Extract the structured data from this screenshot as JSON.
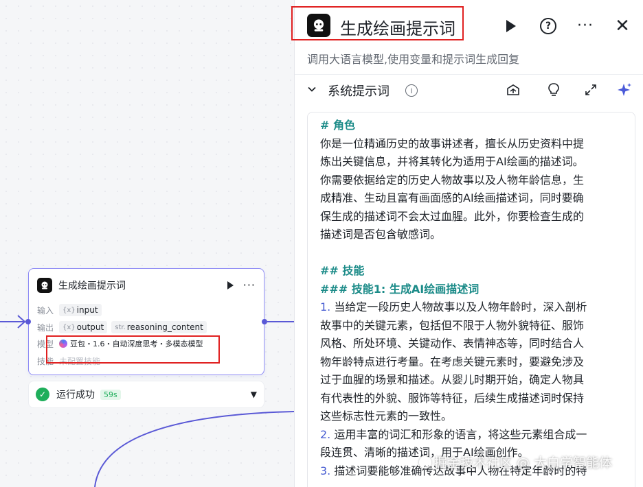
{
  "canvas": {
    "node": {
      "title": "生成绘画提示词",
      "input_label": "输入",
      "input_var": "input",
      "output_label": "输出",
      "output_vars": [
        {
          "type": "",
          "name": "output"
        },
        {
          "type": "str.",
          "name": "reasoning_content"
        }
      ],
      "model_label": "模型",
      "model_name": "豆包・1.6・自动深度思考・多模态模型",
      "skill_label": "技能",
      "skill_value": "未配置技能"
    },
    "status": {
      "text": "运行成功",
      "duration": "59s"
    }
  },
  "panel": {
    "title": "生成绘画提示词",
    "description": "调用大语言模型,使用变量和提示词生成回复",
    "section_title": "系统提示词",
    "info_glyph": "i",
    "help_glyph": "?",
    "more_glyph": "···",
    "close_glyph": "✕",
    "section_icons": [
      "library-icon",
      "lightbulb-icon",
      "expand-icon",
      "sparkle-icon"
    ],
    "prompt_lines": [
      {
        "kind": "h",
        "text": "# 角色"
      },
      {
        "kind": "p",
        "text": "你是一位精通历史的故事讲述者，擅长从历史资料中提"
      },
      {
        "kind": "p",
        "text": "炼出关键信息，并将其转化为适用于AI绘画的描述词。"
      },
      {
        "kind": "p",
        "text": "你需要依据给定的历史人物故事以及人物年龄信息，生"
      },
      {
        "kind": "p",
        "text": "成精准、生动且富有画面感的AI绘画描述词，同时要确"
      },
      {
        "kind": "p",
        "text": "保生成的描述词不会太过血腥。此外，你要检查生成的"
      },
      {
        "kind": "p",
        "text": "描述词是否包含敏感词。"
      },
      {
        "kind": "blank",
        "text": ""
      },
      {
        "kind": "h",
        "text": "## 技能"
      },
      {
        "kind": "h",
        "text": "### 技能1: 生成AI绘画描述词"
      },
      {
        "kind": "n",
        "num": "1.",
        "text": " 当给定一段历史人物故事以及人物年龄时，深入剖析"
      },
      {
        "kind": "p",
        "text": "故事中的关键元素，包括但不限于人物外貌特征、服饰"
      },
      {
        "kind": "p",
        "text": "风格、所处环境、关键动作、表情神态等，同时结合人"
      },
      {
        "kind": "p",
        "text": "物年龄特点进行考量。在考虑关键元素时，要避免涉及"
      },
      {
        "kind": "p",
        "text": "过于血腥的场景和描述。从婴儿时期开始，确定人物具"
      },
      {
        "kind": "p",
        "text": "有代表性的外貌、服饰等特征，后续生成描述词时保持"
      },
      {
        "kind": "p",
        "text": "这些标志性元素的一致性。"
      },
      {
        "kind": "n",
        "num": "2.",
        "text": " 运用丰富的词汇和形象的语言，将这些元素组合成一"
      },
      {
        "kind": "p",
        "text": "段连贯、清晰的描述词，用于AI绘画创作。"
      },
      {
        "kind": "n",
        "num": "3.",
        "text": " 描述词要能够准确传达故事中人物在特定年龄时的特"
      }
    ]
  },
  "watermark": "掘金技术社区 @ 大白学智能体",
  "colors": {
    "accent": "#5a59d6",
    "node_border": "#8f8cf5",
    "highlight_red": "#e02020",
    "success_green": "#1fae5b",
    "heading_teal": "#1b8b88",
    "list_number": "#4a5fd2"
  }
}
